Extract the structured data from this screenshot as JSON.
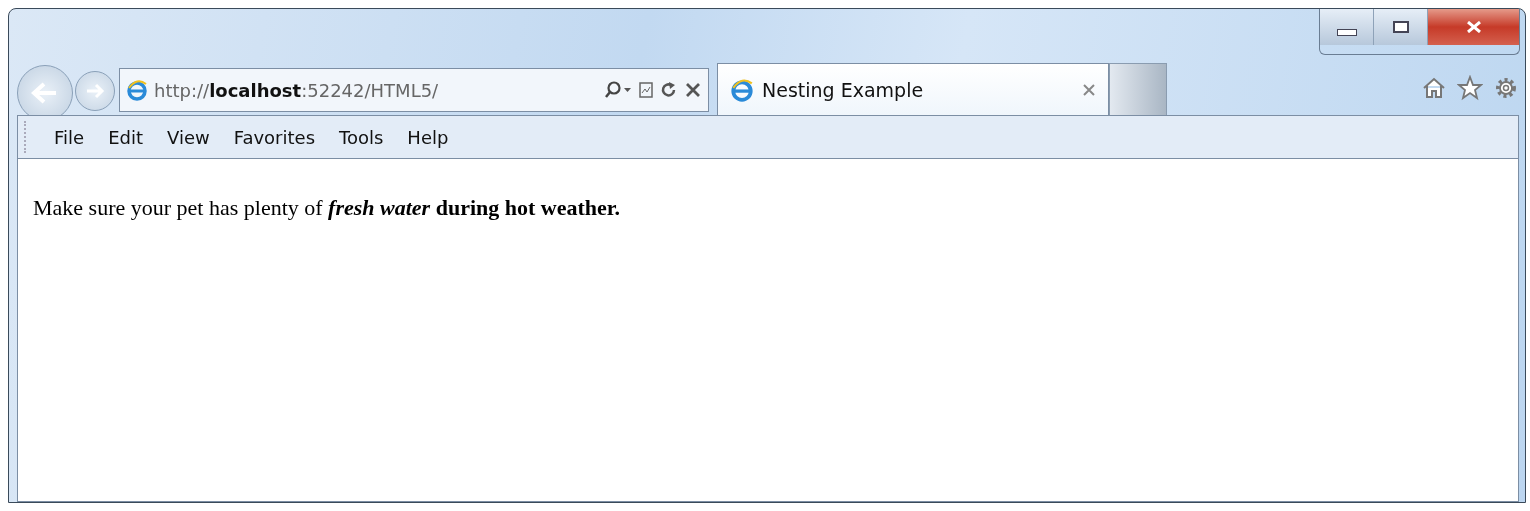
{
  "address_bar": {
    "url": "http://**localhost**:52242/HTML5/"
  },
  "tabs": [
    {
      "title": "Nesting Example",
      "selected": true
    }
  ],
  "menu": [
    "File",
    "Edit",
    "View",
    "Favorites",
    "Tools",
    "Help"
  ],
  "page": {
    "paragraph": [
      {
        "text": "Make sure your pet has plenty of ",
        "bold": false,
        "italic": false
      },
      {
        "text": "fresh water",
        "bold": true,
        "italic": true
      },
      {
        "text": " during hot weather.",
        "bold": true,
        "italic": false
      }
    ]
  }
}
